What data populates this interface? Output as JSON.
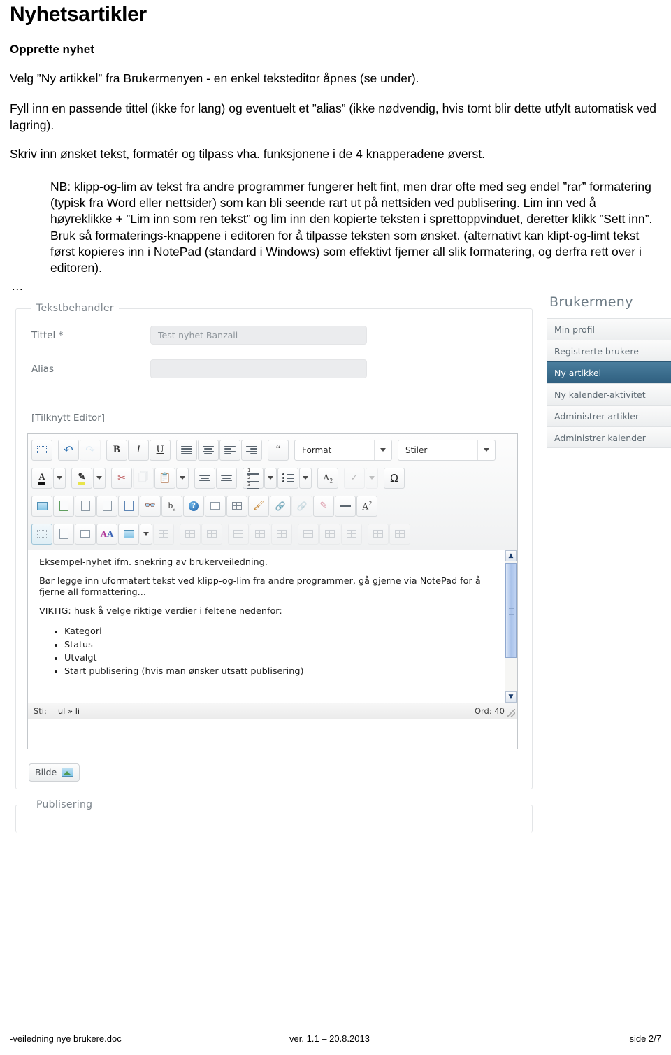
{
  "document": {
    "title": "Nyhetsartikler",
    "subtitle": "Opprette nyhet",
    "paragraphs": [
      "Velg ”Ny artikkel” fra Brukermenyen - en enkel teksteditor åpnes (se under).",
      "Fyll inn en passende tittel (ikke for lang) og eventuelt et ”alias” (ikke nødvendig, hvis tomt blir dette utfylt automatisk ved lagring).",
      "Skriv inn ønsket tekst, formatér og tilpass vha. funksjonene i de 4 knapperadene øverst."
    ],
    "nb_paragraph": "NB: klipp-og-lim av tekst fra andre programmer fungerer helt fint, men drar ofte med seg endel ”rar” formatering (typisk fra Word eller nettsider) som kan bli seende rart ut på nettsiden ved publisering. Lim inn ved å høyreklikke + ”Lim inn som ren tekst” og lim inn den kopierte teksten i sprettoppvinduet, deretter klikk ”Sett inn”. Bruk så formaterings-knappene i editoren for å tilpasse teksten som ønsket. (alternativt kan klipt-og-limt tekst først kopieres inn i NotePad (standard i Windows) som effektivt fjerner all slik formatering, og derfra rett over i editoren).",
    "ellipsis": "…"
  },
  "footer": {
    "file": "-veiledning nye brukere.doc",
    "version": "ver. 1.1 – 20.8.2013",
    "page": "side 2/7"
  },
  "screenshot": {
    "fieldsets": {
      "tekstbehandler_legend": "Tekstbehandler",
      "publisering_legend": "Publisering"
    },
    "form": {
      "title_label": "Tittel *",
      "title_value": "Test-nyhet Banzaii",
      "alias_label": "Alias",
      "alias_value": "",
      "editor_link": "[Tilknytt Editor]"
    },
    "editor": {
      "combo_format": "Format",
      "combo_stiler": "Stiler",
      "content": {
        "paragraphs": [
          "Eksempel-nyhet ifm. snekring av brukerveiledning.",
          "Bør legge inn uformatert tekst ved klipp-og-lim fra andre programmer, gå gjerne via NotePad for å fjerne all formattering...",
          "VIKTIG: husk å velge riktige verdier i feltene nedenfor:"
        ],
        "bullets": [
          "Kategori",
          "Status",
          "Utvalgt",
          "Start publisering (hvis man ønsker utsatt publisering)"
        ]
      },
      "status": {
        "path_label": "Sti:",
        "path_value": "ul » li",
        "words": "Ord: 40"
      },
      "toolbar_row1": [
        {
          "name": "maximize-icon",
          "glyph": "maximize",
          "disabled": false,
          "selected": false
        },
        {
          "name": "undo-icon",
          "glyph": "undo",
          "disabled": false,
          "selected": false
        },
        {
          "name": "redo-icon",
          "glyph": "redo",
          "disabled": true,
          "selected": false
        },
        {
          "name": "bold-icon",
          "glyph": "B",
          "disabled": false,
          "selected": false
        },
        {
          "name": "italic-icon",
          "glyph": "I",
          "disabled": false,
          "selected": false
        },
        {
          "name": "underline-icon",
          "glyph": "U",
          "disabled": false,
          "selected": false
        },
        {
          "name": "align-justify-icon",
          "glyph": "justify",
          "disabled": false,
          "selected": false
        },
        {
          "name": "align-center-icon",
          "glyph": "center",
          "disabled": false,
          "selected": false
        },
        {
          "name": "align-left-icon",
          "glyph": "left",
          "disabled": false,
          "selected": false
        },
        {
          "name": "align-right-icon",
          "glyph": "right",
          "disabled": false,
          "selected": false
        },
        {
          "name": "blockquote-icon",
          "glyph": "quote",
          "disabled": false,
          "selected": false
        }
      ],
      "toolbar_row2": [
        {
          "name": "text-color-icon",
          "glyph": "textcolor",
          "disabled": false,
          "selected": false
        },
        {
          "name": "text-color-dropdown-icon",
          "glyph": "caret",
          "disabled": false,
          "selected": false
        },
        {
          "name": "highlight-color-icon",
          "glyph": "highlight",
          "disabled": false,
          "selected": false
        },
        {
          "name": "highlight-color-dropdown-icon",
          "glyph": "caret",
          "disabled": false,
          "selected": false
        },
        {
          "name": "cut-icon",
          "glyph": "scissors",
          "disabled": false,
          "selected": false
        },
        {
          "name": "copy-icon",
          "glyph": "copy",
          "disabled": true,
          "selected": false
        },
        {
          "name": "paste-icon",
          "glyph": "paste",
          "disabled": false,
          "selected": false
        },
        {
          "name": "paste-dropdown-icon",
          "glyph": "caret",
          "disabled": false,
          "selected": false
        },
        {
          "name": "outdent-icon",
          "glyph": "outdent",
          "disabled": false,
          "selected": false
        },
        {
          "name": "indent-icon",
          "glyph": "indent",
          "disabled": false,
          "selected": false
        },
        {
          "name": "numbered-list-icon",
          "glyph": "numlist",
          "disabled": false,
          "selected": false
        },
        {
          "name": "numbered-list-dropdown-icon",
          "glyph": "caret",
          "disabled": false,
          "selected": false
        },
        {
          "name": "bulleted-list-icon",
          "glyph": "dotlist",
          "disabled": false,
          "selected": false
        },
        {
          "name": "bulleted-list-dropdown-icon",
          "glyph": "caret",
          "disabled": false,
          "selected": false
        },
        {
          "name": "subscript-icon",
          "glyph": "A2",
          "disabled": false,
          "selected": false
        },
        {
          "name": "spellcheck-icon",
          "glyph": "spell",
          "disabled": true,
          "selected": false
        },
        {
          "name": "spellcheck-dropdown-icon",
          "glyph": "caret",
          "disabled": true,
          "selected": false
        },
        {
          "name": "special-character-icon",
          "glyph": "omega",
          "disabled": false,
          "selected": false
        }
      ],
      "toolbar_row3": [
        {
          "name": "insert-image-icon",
          "glyph": "image",
          "disabled": false,
          "selected": false
        },
        {
          "name": "insert-file-icon",
          "glyph": "filegreen",
          "disabled": false,
          "selected": false
        },
        {
          "name": "document-properties-icon",
          "glyph": "filegear",
          "disabled": false,
          "selected": false
        },
        {
          "name": "page-properties-icon",
          "glyph": "filesearch",
          "disabled": false,
          "selected": false
        },
        {
          "name": "source-code-icon",
          "glyph": "code",
          "disabled": false,
          "selected": false
        },
        {
          "name": "find-icon",
          "glyph": "binoculars",
          "disabled": false,
          "selected": false
        },
        {
          "name": "replace-icon",
          "glyph": "replace",
          "disabled": false,
          "selected": false
        },
        {
          "name": "help-icon",
          "glyph": "help",
          "disabled": false,
          "selected": false
        },
        {
          "name": "page-break-icon",
          "glyph": "pagebreak",
          "disabled": false,
          "selected": false
        },
        {
          "name": "templates-icon",
          "glyph": "template",
          "disabled": false,
          "selected": false
        },
        {
          "name": "remove-format-icon",
          "glyph": "brush",
          "disabled": false,
          "selected": false
        },
        {
          "name": "link-icon",
          "glyph": "link",
          "disabled": false,
          "selected": false
        },
        {
          "name": "unlink-icon",
          "glyph": "unlink",
          "disabled": true,
          "selected": false
        },
        {
          "name": "anchor-icon",
          "glyph": "anchor",
          "disabled": false,
          "selected": false
        },
        {
          "name": "horizontal-rule-icon",
          "glyph": "hr",
          "disabled": false,
          "selected": false
        },
        {
          "name": "superscript-icon",
          "glyph": "Asup",
          "disabled": false,
          "selected": false
        }
      ],
      "toolbar_row4": [
        {
          "name": "show-blocks-icon",
          "glyph": "blocks",
          "disabled": false,
          "selected": true
        },
        {
          "name": "preview-icon",
          "glyph": "preview",
          "disabled": false,
          "selected": false
        },
        {
          "name": "save-icon",
          "glyph": "save",
          "disabled": false,
          "selected": false
        },
        {
          "name": "spell-as-you-type-icon",
          "glyph": "AAcolor",
          "disabled": false,
          "selected": false
        },
        {
          "name": "table-icon",
          "glyph": "table",
          "disabled": false,
          "selected": false
        },
        {
          "name": "table-dropdown-icon",
          "glyph": "caret",
          "disabled": false,
          "selected": false
        },
        {
          "name": "delete-table-icon",
          "glyph": "tabledel",
          "disabled": true,
          "selected": false
        },
        {
          "name": "merge-cells-icon",
          "glyph": "tblA",
          "disabled": true,
          "selected": false
        },
        {
          "name": "split-cell-icon",
          "glyph": "tblB",
          "disabled": true,
          "selected": false
        },
        {
          "name": "insert-row-before-icon",
          "glyph": "tblC",
          "disabled": true,
          "selected": false
        },
        {
          "name": "insert-row-after-icon",
          "glyph": "tblD",
          "disabled": true,
          "selected": false
        },
        {
          "name": "delete-row-icon",
          "glyph": "tblE",
          "disabled": true,
          "selected": false
        },
        {
          "name": "insert-column-before-icon",
          "glyph": "tblF",
          "disabled": true,
          "selected": false
        },
        {
          "name": "insert-column-after-icon",
          "glyph": "tblG",
          "disabled": true,
          "selected": false
        },
        {
          "name": "delete-column-icon",
          "glyph": "tblH",
          "disabled": true,
          "selected": false
        },
        {
          "name": "table-properties-icon",
          "glyph": "tblI",
          "disabled": true,
          "selected": false
        },
        {
          "name": "cell-properties-icon",
          "glyph": "tblJ",
          "disabled": true,
          "selected": false
        }
      ]
    },
    "image_button": "Bilde",
    "sidebar": {
      "title": "Brukermeny",
      "items": [
        {
          "label": "Min profil",
          "active": false
        },
        {
          "label": "Registrerte brukere",
          "active": false
        },
        {
          "label": "Ny artikkel",
          "active": true
        },
        {
          "label": "Ny kalender-aktivitet",
          "active": false
        },
        {
          "label": "Administrer artikler",
          "active": false
        },
        {
          "label": "Administrer kalender",
          "active": false
        }
      ]
    }
  },
  "colors": {
    "sidebar_active_bg": "#3a6e93",
    "input_bg": "#ebecee",
    "scrollbar_thumb": "#a9c2ea"
  }
}
